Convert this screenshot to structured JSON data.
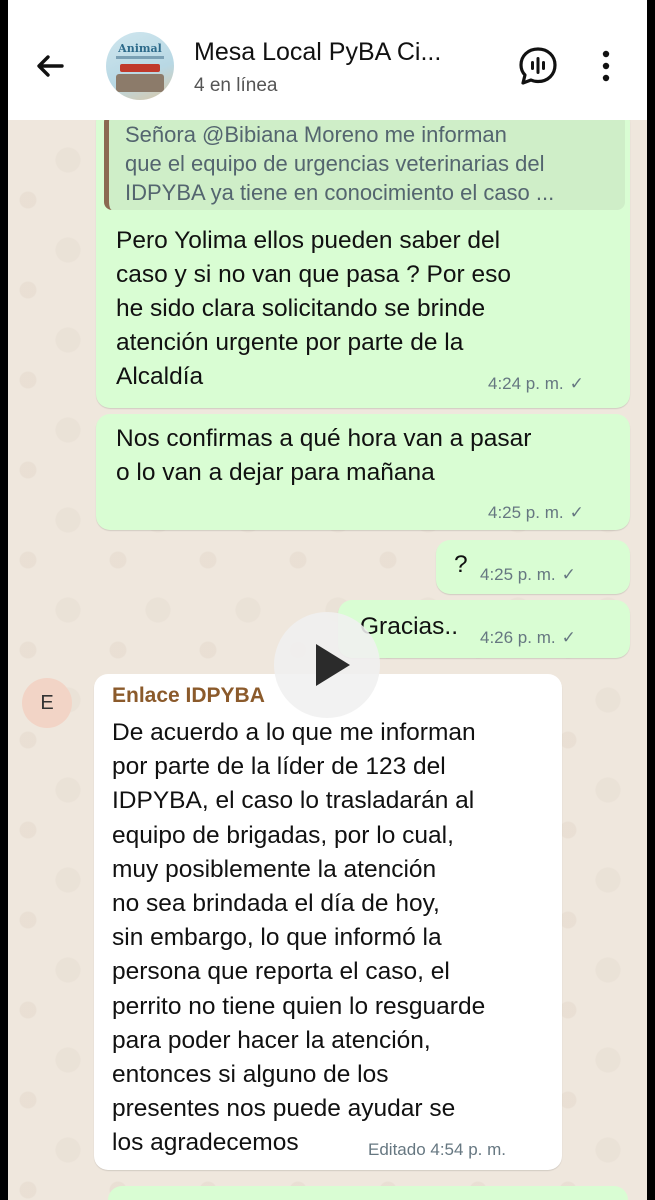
{
  "header": {
    "title": "Mesa Local PyBA Ci...",
    "subtitle": "4 en línea",
    "avatar_text": "Animal"
  },
  "messages": {
    "quoted": "Señora @Bibiana Moreno me informan\nque el equipo de urgencias veterinarias del\nIDPYBA ya tiene en conocimiento el caso ...",
    "m1_text": "Pero Yolima ellos pueden saber del\ncaso y si no van que pasa ? Por eso\nhe sido clara solicitando se brinde\natención urgente por parte de la\nAlcaldía",
    "m1_time": "4:24 p. m.",
    "m2_text": "Nos confirmas a qué hora van a pasar\no lo van a dejar para mañana",
    "m2_time": "4:25 p. m.",
    "m3_text": "?",
    "m3_time": "4:25 p. m.",
    "m4_text": "Gracias..",
    "m4_time": "4:26 p. m.",
    "incoming": {
      "avatar_letter": "E",
      "sender": "Enlace IDPYBA",
      "text": "De acuerdo a lo que me informan\npor parte de la líder de 123 del\nIDPYBA, el caso lo trasladarán al\nequipo de brigadas, por lo cual,\nmuy posiblemente la atención\nno sea brindada el día de hoy,\nsin embargo, lo que informó la\npersona que reporta el caso, el\nperrito no tiene quien lo resguarde\npara poder hacer la atención,\nentonces si alguno de los\npresentes nos puede ayudar se\nlos agradecemos",
      "meta": "Editado 4:54 p. m."
    },
    "tick": "✓"
  },
  "colors": {
    "outgoing_bubble": "#d9fdd3",
    "incoming_bubble": "#ffffff",
    "chat_background": "#efe7dd",
    "quote_bar": "#8b6a52",
    "sender_name": "#8b5a2b"
  }
}
